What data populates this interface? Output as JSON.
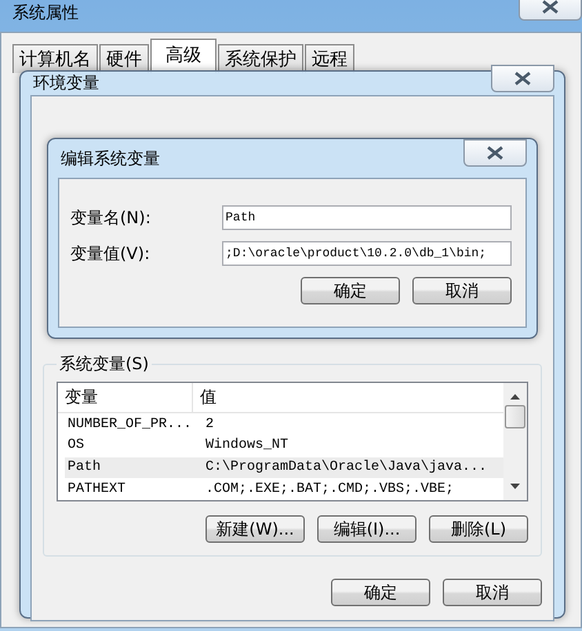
{
  "outer_window": {
    "title": "系统属性",
    "tabs": [
      {
        "label": "计算机名",
        "selected": false
      },
      {
        "label": "硬件",
        "selected": false
      },
      {
        "label": "高级",
        "selected": true
      },
      {
        "label": "系统保护",
        "selected": false
      },
      {
        "label": "远程",
        "selected": false
      }
    ]
  },
  "env_window": {
    "title": "环境变量",
    "system_variables": {
      "legend": "系统变量(S)",
      "columns": [
        "变量",
        "值"
      ],
      "rows": [
        {
          "name": "NUMBER_OF_PR...",
          "value": "2",
          "selected": false
        },
        {
          "name": "OS",
          "value": "Windows_NT",
          "selected": false
        },
        {
          "name": "Path",
          "value": "C:\\ProgramData\\Oracle\\Java\\java...",
          "selected": true
        },
        {
          "name": "PATHEXT",
          "value": ".COM;.EXE;.BAT;.CMD;.VBS;.VBE;",
          "selected": false
        }
      ],
      "buttons": [
        "新建(W)...",
        "编辑(I)...",
        "删除(L)"
      ]
    },
    "buttons": [
      "确定",
      "取消"
    ]
  },
  "edit_dialog": {
    "title": "编辑系统变量",
    "fields": [
      {
        "label": "变量名(N):",
        "value": "Path"
      },
      {
        "label": "变量值(V):",
        "value": ";D:\\oracle\\product\\10.2.0\\db_1\\bin;"
      }
    ],
    "buttons": [
      "确定",
      "取消"
    ]
  }
}
